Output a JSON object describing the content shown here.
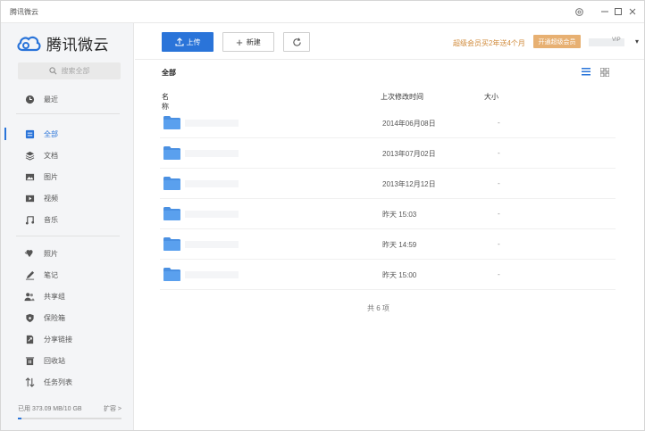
{
  "app": {
    "title": "腾讯微云",
    "logo_text": "腾讯微云",
    "accent_color": "#2a74d9"
  },
  "sidebar": {
    "search_placeholder": "搜索全部",
    "items": [
      {
        "label": "最近",
        "icon": "clock-icon"
      },
      {
        "label": "全部",
        "icon": "all-files-icon"
      },
      {
        "label": "文档",
        "icon": "document-icon"
      },
      {
        "label": "图片",
        "icon": "image-icon"
      },
      {
        "label": "视频",
        "icon": "video-icon"
      },
      {
        "label": "音乐",
        "icon": "music-icon"
      },
      {
        "label": "照片",
        "icon": "photo-icon"
      },
      {
        "label": "笔记",
        "icon": "note-icon"
      },
      {
        "label": "共享组",
        "icon": "share-group-icon"
      },
      {
        "label": "保险箱",
        "icon": "safe-icon"
      },
      {
        "label": "分享链接",
        "icon": "share-link-icon"
      },
      {
        "label": "回收站",
        "icon": "trash-icon"
      },
      {
        "label": "任务列表",
        "icon": "task-list-icon"
      }
    ],
    "active_item": "全部",
    "storage_text": "已用 373.09 MB/10 GB",
    "expand_label": "扩容 >",
    "storage_used_fraction": 0.036
  },
  "toolbar": {
    "upload_label": "上传",
    "new_label": "新建",
    "refresh_icon": "refresh-icon",
    "promo_text": "超级会员买2年送4个月",
    "vip_button_label": "开通超级会员",
    "vip_tag": "VIP",
    "dropdown_icon": "caret-down-icon"
  },
  "content": {
    "breadcrumb": "全部",
    "columns": {
      "name": "名称",
      "modified": "上次修改时间",
      "size": "大小"
    },
    "files": [
      {
        "modified": "2014年06月08日",
        "size": "-"
      },
      {
        "modified": "2013年07月02日",
        "size": "-"
      },
      {
        "modified": "2013年12月12日",
        "size": "-"
      },
      {
        "modified": "昨天 15:03",
        "size": "-"
      },
      {
        "modified": "昨天 14:59",
        "size": "-"
      },
      {
        "modified": "昨天 15:00",
        "size": "-"
      }
    ],
    "count_text": "共 6 项"
  }
}
